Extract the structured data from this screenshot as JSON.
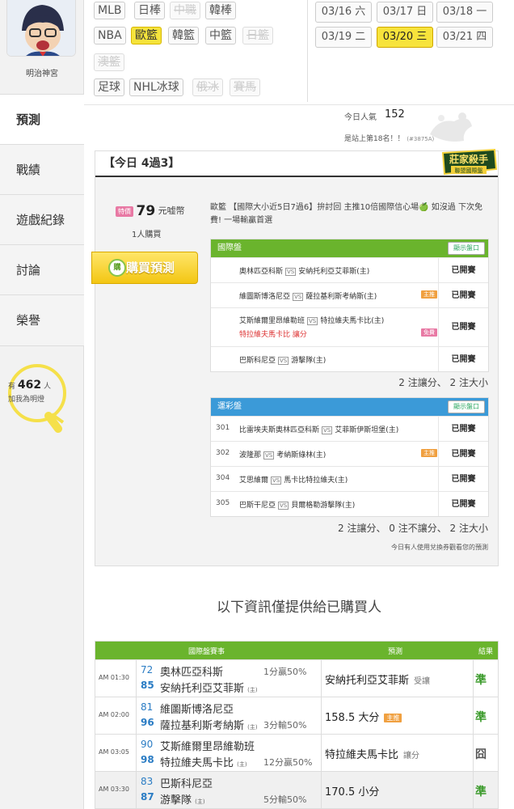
{
  "user": {
    "name": "明治神宮"
  },
  "nav": [
    {
      "label": "預測",
      "active": true
    },
    {
      "label": "戰績",
      "active": false
    },
    {
      "label": "遊戲紀錄",
      "active": false
    },
    {
      "label": "討論",
      "active": false
    },
    {
      "label": "榮譽",
      "active": false
    }
  ],
  "clarity": {
    "prefix": "有",
    "count": "462",
    "suffix": "人",
    "line2": "加我為明燈"
  },
  "leagues": [
    {
      "label": "MLB",
      "state": "normal"
    },
    {
      "label": "日棒",
      "state": "normal"
    },
    {
      "label": "中職",
      "state": "disabled"
    },
    {
      "label": "韓棒",
      "state": "normal"
    },
    {
      "label": "NBA",
      "state": "normal"
    },
    {
      "label": "歐籃",
      "state": "selected"
    },
    {
      "label": "韓籃",
      "state": "normal"
    },
    {
      "label": "中籃",
      "state": "normal"
    },
    {
      "label": "日籃",
      "state": "disabled"
    },
    {
      "label": "澳籃",
      "state": "disabled"
    },
    {
      "label": "足球",
      "state": "normal"
    },
    {
      "label": "NHL冰球",
      "state": "normal"
    },
    {
      "label": "俄冰",
      "state": "disabled"
    },
    {
      "label": "賽馬",
      "state": "disabled"
    }
  ],
  "dates": [
    {
      "label": "03/16 六",
      "selected": false
    },
    {
      "label": "03/17 日",
      "selected": false
    },
    {
      "label": "03/18 一",
      "selected": false
    },
    {
      "label": "03/19 二",
      "selected": false
    },
    {
      "label": "03/20 三",
      "selected": true
    },
    {
      "label": "03/21 四",
      "selected": false
    }
  ],
  "popularity": {
    "label": "今日人氣",
    "value": "152",
    "rank": "是站上第18名！！",
    "rank_note": "(#3875A)"
  },
  "card": {
    "title": "【今日 4過3】",
    "badge_line1": "莊家殺手",
    "badge_line2": "聯盟國際盤",
    "special_label": "特價",
    "price": "79",
    "price_unit": "元嘘幣",
    "buyers": "1人購買",
    "buy_label": "購買預測",
    "buy_icon": "購",
    "description": "歐籃 【國際大小近5日7過6】拚討回 主推10倍國際信心場🍏 如沒過 下次免費! 一場輸贏首選",
    "intl": {
      "header": "國際盤",
      "show_label": "顯示盤口",
      "rows": [
        {
          "num": "",
          "away": "奧林匹亞科斯",
          "home": "安納托利亞艾菲斯(主)",
          "tag": "",
          "extra": "",
          "status": "已開賽"
        },
        {
          "num": "",
          "away": "維圖斯博洛尼亞",
          "home": "薩拉基利斯考納斯(主)",
          "tag": "主推",
          "extra": "",
          "status": "已開賽"
        },
        {
          "num": "",
          "away": "艾斯維爾里昂維勒班",
          "home": "特拉維夫馬卡比(主)",
          "tag": "",
          "extra": "特拉維夫馬卡比 讓分",
          "extra_tag": "免費",
          "status": "已開賽"
        },
        {
          "num": "",
          "away": "巴斯科尼亞",
          "home": "游擊隊(主)",
          "tag": "",
          "extra": "",
          "status": "已開賽"
        }
      ],
      "summary": "2 注讓分、 2 注大小"
    },
    "lottery": {
      "header": "運彩盤",
      "show_label": "顯示盤口",
      "rows": [
        {
          "num": "301",
          "away": "比雷埃夫斯奧林匹亞科斯",
          "home": "艾菲斯伊斯坦堡(主)",
          "tag": "",
          "status": "已開賽"
        },
        {
          "num": "302",
          "away": "波隆那",
          "home": "考納斯綠林(主)",
          "tag": "主推",
          "status": "已開賽"
        },
        {
          "num": "304",
          "away": "艾思維爾",
          "home": "馬卡比特拉維夫(主)",
          "tag": "",
          "status": "已開賽"
        },
        {
          "num": "305",
          "away": "巴斯干尼亞",
          "home": "貝爾格勒游擊隊(主)",
          "tag": "",
          "status": "已開賽"
        }
      ],
      "summary": "2 注讓分、 0 注不讓分、 2 注大小"
    },
    "note": "今日有人使用兌換券觀看您的預測"
  },
  "info_title": "以下資訊僅提供給已購買人",
  "purchased": {
    "headers": [
      "國際盤賽事",
      "預測",
      "結果"
    ],
    "rows": [
      {
        "time": "AM 01:30",
        "n1": "72",
        "t1": "奧林匹亞科斯",
        "o1": "1分贏50%",
        "n2": "85",
        "t2": "安納托利亞艾菲斯",
        "host": "(主)",
        "o2": "",
        "pick": "安納托利亞艾菲斯",
        "pick_sub": "受讓",
        "pick_tag": "",
        "result": "準",
        "result_color": "#3a9a2a"
      },
      {
        "time": "AM 02:00",
        "n1": "81",
        "t1": "維圖斯博洛尼亞",
        "o1": "",
        "n2": "96",
        "t2": "薩拉基利斯考納斯",
        "host": "(主)",
        "o2": "3分輸50%",
        "pick": "158.5 大分",
        "pick_sub": "",
        "pick_tag": "主推",
        "result": "準",
        "result_color": "#3a9a2a"
      },
      {
        "time": "AM 03:05",
        "n1": "90",
        "t1": "艾斯維爾里昂維勒班",
        "o1": "",
        "n2": "98",
        "t2": "特拉維夫馬卡比",
        "host": "(主)",
        "o2": "12分贏50%",
        "pick": "特拉維夫馬卡比",
        "pick_sub": "讓分",
        "pick_tag": "",
        "result": "囧",
        "result_color": "#555555"
      },
      {
        "time": "AM 03:30",
        "n1": "83",
        "t1": "巴斯科尼亞",
        "o1": "",
        "n2": "87",
        "t2": "游擊隊",
        "host": "(主)",
        "o2": "5分輸50%",
        "pick": "170.5 小分",
        "pick_sub": "",
        "pick_tag": "",
        "result": "準",
        "result_color": "#3a9a2a"
      }
    ]
  },
  "colors": {
    "accent_green": "#6ab42d",
    "accent_blue": "#3b9ad8",
    "selected_yellow": "#f5e33b"
  }
}
